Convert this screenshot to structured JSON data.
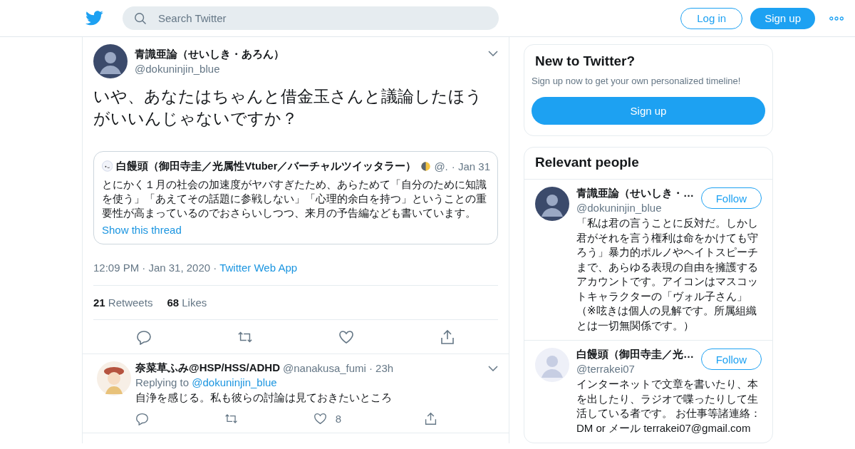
{
  "header": {
    "search": {
      "placeholder": "Search Twitter"
    },
    "login": "Log in",
    "signup": "Sign up"
  },
  "tweet": {
    "name": "青識亜論（せいしき・あろん）",
    "handle": "@dokuninjin_blue",
    "text": "いや、あなたはちゃんと借金玉さんと議論したほうがいいんじゃないですか？",
    "quote": {
      "name": "白饅頭（御田寺圭／光属性Vtuber／バーチャルツイッタラー）",
      "handle": "@.",
      "time": "· Jan 31",
      "text": "とにかく１月の社会の加速度がヤバすぎたため、あらためて「自分のために知識を使う」「あえてその話題に参戦しない」「心理的余白を持つ」ということの重要性が高まっているのでおさらいしつつ、来月の予告編なども書いています。",
      "link": "Show this thread"
    },
    "time": "12:09 PM",
    "date": "· Jan 31, 2020",
    "separator": "·",
    "source": "Twitter Web App",
    "stats": [
      {
        "count": "21",
        "label": "Retweets"
      },
      {
        "count": "68",
        "label": "Likes"
      }
    ]
  },
  "replies": [
    {
      "name": "奈菜草ふみ@HSP/HSS/ADHD",
      "handle": "@nanakusa_fumi",
      "time": "· 23h",
      "replying_label": "Replying to",
      "replying_to": "@dokuninjin_blue",
      "text": "自浄を感じる。私も彼らの討論は見ておきたいところ",
      "like_count": "8"
    }
  ],
  "sidebar": {
    "new_card": {
      "title": "New to Twitter?",
      "text": "Sign up now to get your own personalized timeline!",
      "button": "Sign up"
    },
    "people": {
      "title": "Relevant people",
      "items": [
        {
          "name": "青識亜論（せいしき・…",
          "handle": "@dokuninjin_blue",
          "button": "Follow",
          "bio": "「私は君の言うことに反対だ。しかし君がそれを言う権利は命をかけても守ろう」暴力的ポルノやヘイトスピーチまで、あらゆる表現の自由を擁護するアカウントです。アイコンはマスコットキャラクターの「ヴォル子さん」（※呟きは個人の見解です。所属組織とは一切無関係です。）"
        },
        {
          "name": "白饅頭（御田寺圭／光…",
          "handle": "@terrakei07",
          "button": "Follow",
          "bio": "インターネットで文章を書いたり、本を出したり、ラジオで喋ったりして生活している者です。 お仕事等諸連絡：DM or メール terrakei07@gmail.com"
        }
      ]
    }
  }
}
